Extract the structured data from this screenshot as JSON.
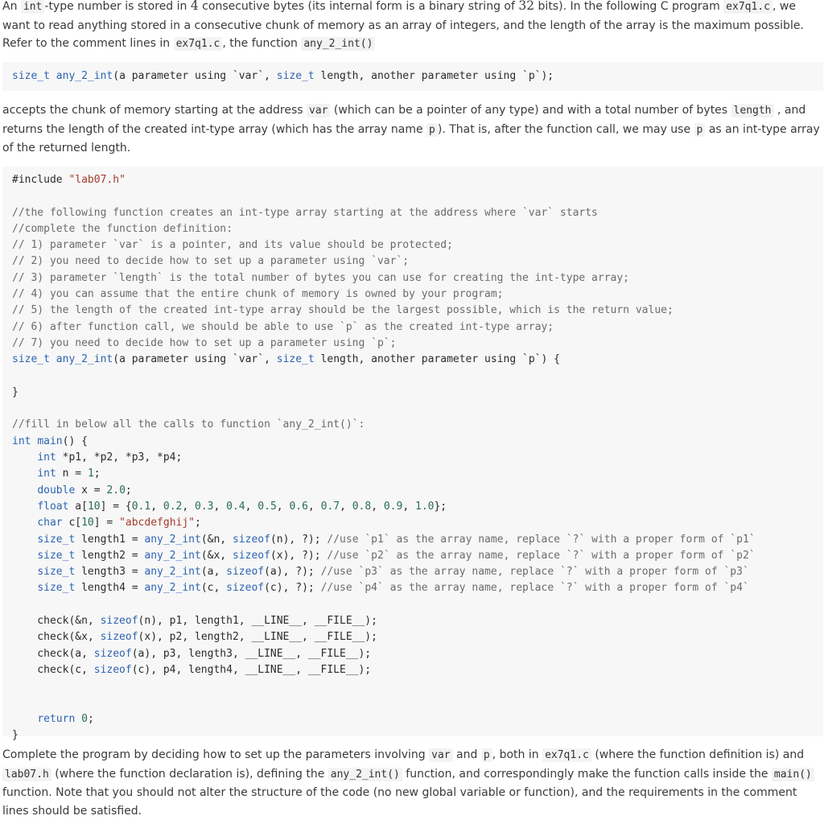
{
  "intro": {
    "t1": "An ",
    "c1": "int",
    "t2": "-type number is stored in ",
    "m1": "4",
    "t3": " consecutive bytes (its internal form is a binary string of ",
    "m2": "32",
    "t4": " bits). In the following C program ",
    "c2": "ex7q1.c",
    "t5": ", we want to read anything stored in a consecutive chunk of memory as an array of integers, and the length of the array is the maximum possible. Refer to the comment lines in ",
    "c3": "ex7q1.c",
    "t6": ", the function ",
    "c4": "any_2_int()"
  },
  "signature_block": "size_t any_2_int(a parameter using `var`, size_t length, another parameter using `p`);",
  "middle": {
    "t1": "accepts the chunk of memory starting at the address ",
    "c1": "var",
    "t2": " (which can be a pointer of any type) and with a total number of bytes ",
    "c2": "length",
    "t3": " , and returns the length of the created int-type array (which has the array name ",
    "c3": "p",
    "t4": "). That is, after the function call, we may use ",
    "c4": "p",
    "t5": " as an int-type array of the returned length."
  },
  "program_lines": [
    "#include \"lab07.h\"",
    "",
    "//the following function creates an int-type array starting at the address where `var` starts",
    "//complete the function definition:",
    "// 1) parameter `var` is a pointer, and its value should be protected;",
    "// 2) you need to decide how to set up a parameter using `var`;",
    "// 3) parameter `length` is the total number of bytes you can use for creating the int-type array;",
    "// 4) you can assume that the entire chunk of memory is owned by your program;",
    "// 5) the length of the created int-type array should be the largest possible, which is the return value;",
    "// 6) after function call, we should be able to use `p` as the created int-type array;",
    "// 7) you need to decide how to set up a parameter using `p`;",
    "size_t any_2_int(a parameter using `var`, size_t length, another parameter using `p`) {",
    "",
    "}",
    "",
    "//fill in below all the calls to function `any_2_int()`:",
    "int main() {",
    "    int *p1, *p2, *p3, *p4;",
    "    int n = 1;",
    "    double x = 2.0;",
    "    float a[10] = {0.1, 0.2, 0.3, 0.4, 0.5, 0.6, 0.7, 0.8, 0.9, 1.0};",
    "    char c[10] = \"abcdefghij\";",
    "    size_t length1 = any_2_int(&n, sizeof(n), ?); //use `p1` as the array name, replace `?` with a proper form of `p1`",
    "    size_t length2 = any_2_int(&x, sizeof(x), ?); //use `p2` as the array name, replace `?` with a proper form of `p2`",
    "    size_t length3 = any_2_int(a, sizeof(a), ?); //use `p3` as the array name, replace `?` with a proper form of `p3`",
    "    size_t length4 = any_2_int(c, sizeof(c), ?); //use `p4` as the array name, replace `?` with a proper form of `p4`",
    "",
    "    check(&n, sizeof(n), p1, length1, __LINE__, __FILE__);",
    "    check(&x, sizeof(x), p2, length2, __LINE__, __FILE__);",
    "    check(a, sizeof(a), p3, length3, __LINE__, __FILE__);",
    "    check(c, sizeof(c), p4, length4, __LINE__, __FILE__);",
    "",
    "",
    "    return 0;",
    "}"
  ],
  "outro": {
    "t1": "Complete the program by deciding how to set up the parameters involving ",
    "c1": "var",
    "t2": " and ",
    "c2": "p",
    "t3": ", both in ",
    "c3": "ex7q1.c",
    "t4": " (where the function definition is) and ",
    "c4": "lab07.h",
    "t5": " (where the function declaration is), defining the ",
    "c5": "any_2_int()",
    "t6": " function, and correspondingly make the function calls inside the ",
    "c6": "main()",
    "t7": " function. Note that you should not alter the structure of the code (no new global variable or function), and the requirements in the comment lines should be satisfied."
  }
}
